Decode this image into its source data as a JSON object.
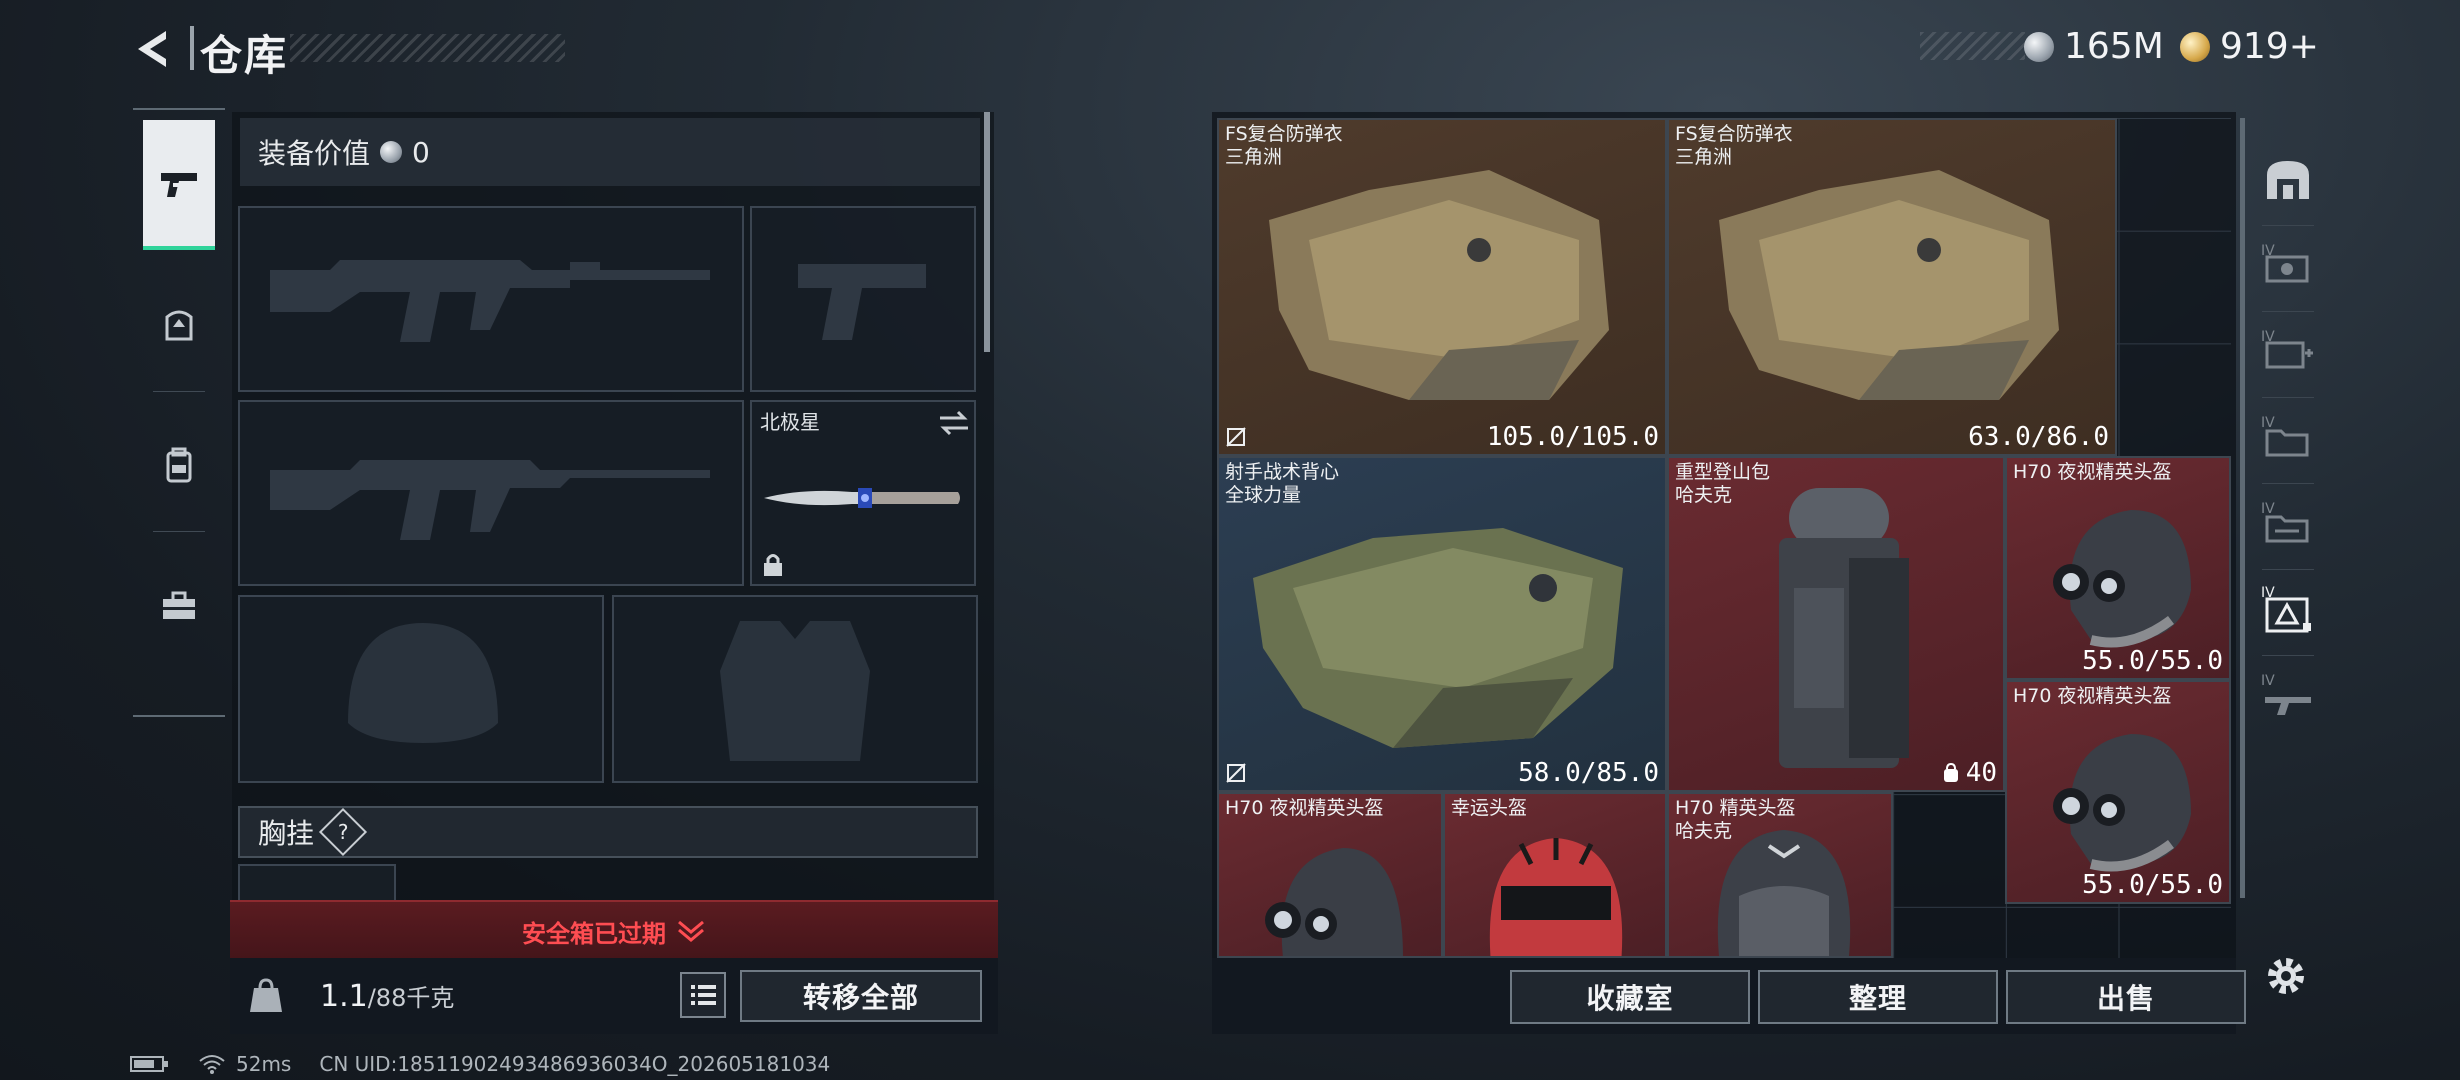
{
  "header": {
    "title": "仓库",
    "currency_silver": "165M",
    "currency_gold": "919+"
  },
  "left_tabs": [
    {
      "icon": "pistol-icon",
      "active": true
    },
    {
      "icon": "helmet-armor-icon",
      "active": false
    },
    {
      "icon": "backpack-icon",
      "active": false
    },
    {
      "icon": "toolbox-icon",
      "active": false
    }
  ],
  "loadout": {
    "equipment_value_label": "装备价值",
    "equipment_value": "0",
    "melee_slot_label": "北极星",
    "chest_rig_label": "胸挂",
    "chest_rig_help": "?",
    "safe_box_status": "安全箱已过期",
    "weight_current": "1.1",
    "weight_max": "/88千克",
    "transfer_all": "转移全部"
  },
  "stash_items": [
    {
      "name": "FS复合防弹衣\n三角洲",
      "durability": "105.0/105.0",
      "color": "brown"
    },
    {
      "name": "FS复合防弹衣\n三角洲",
      "durability": "63.0/86.0",
      "color": "brown"
    },
    {
      "name": "射手战术背心\n全球力量",
      "durability": "58.0/85.0",
      "color": "blue"
    },
    {
      "name": "重型登山包\n哈夫克",
      "count": "40",
      "color": "red"
    },
    {
      "name": "H70 夜视精英头盔",
      "durability": "55.0/55.0",
      "color": "red"
    },
    {
      "name": "H70 夜视精英头盔",
      "durability": "55.0/55.0",
      "color": "red"
    },
    {
      "name": "H70 夜视精英头盔",
      "color": "red"
    },
    {
      "name": "幸运头盔",
      "color": "red"
    },
    {
      "name": "H70 精英头盔\n哈夫克",
      "color": "red"
    }
  ],
  "stash_actions": {
    "collection": "收藏室",
    "sort": "整理",
    "sell": "出售"
  },
  "right_tabs": [
    "house-icon",
    "tier4-card-icon",
    "tier4-medkit-icon",
    "tier4-folder-icon",
    "tier4-folder2-icon",
    "tier4-armor-icon",
    "tier4-weapon-icon"
  ],
  "status_bar": {
    "ping": "52ms",
    "uid": "CN UID:18511902493486936034O_202605181034"
  }
}
